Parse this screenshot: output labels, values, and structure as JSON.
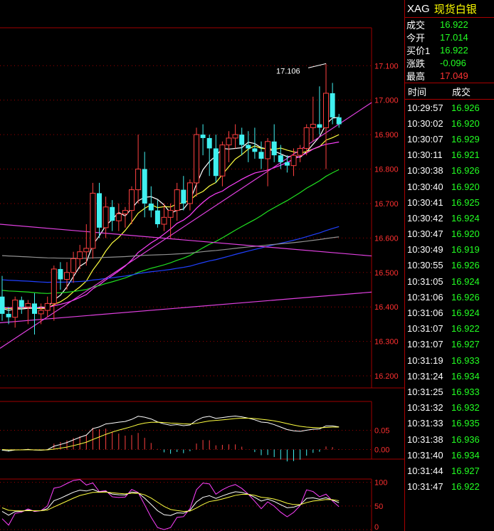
{
  "header": {
    "symbol": "XAG",
    "name": "现货白银"
  },
  "quote": [
    {
      "label": "成交",
      "value": "16.922",
      "color": "green"
    },
    {
      "label": "今开",
      "value": "17.014",
      "color": "green"
    },
    {
      "label": "买价1",
      "value": "16.922",
      "color": "green"
    },
    {
      "label": "涨跌",
      "value": "-0.096",
      "color": "green"
    },
    {
      "label": "最高",
      "value": "17.049",
      "color": "red"
    }
  ],
  "trades_header": {
    "time": "时间",
    "price": "成交"
  },
  "trades": [
    {
      "time": "10:29:57",
      "price": "16.926"
    },
    {
      "time": "10:30:02",
      "price": "16.920"
    },
    {
      "time": "10:30:07",
      "price": "16.929"
    },
    {
      "time": "10:30:11",
      "price": "16.921"
    },
    {
      "time": "10:30:38",
      "price": "16.926"
    },
    {
      "time": "10:30:40",
      "price": "16.920"
    },
    {
      "time": "10:30:41",
      "price": "16.925"
    },
    {
      "time": "10:30:42",
      "price": "16.924"
    },
    {
      "time": "10:30:47",
      "price": "16.920"
    },
    {
      "time": "10:30:49",
      "price": "16.919"
    },
    {
      "time": "10:30:55",
      "price": "16.926"
    },
    {
      "time": "10:31:05",
      "price": "16.924"
    },
    {
      "time": "10:31:06",
      "price": "16.926"
    },
    {
      "time": "10:31:06",
      "price": "16.924"
    },
    {
      "time": "10:31:07",
      "price": "16.922"
    },
    {
      "time": "10:31:07",
      "price": "16.927"
    },
    {
      "time": "10:31:19",
      "price": "16.933"
    },
    {
      "time": "10:31:24",
      "price": "16.934"
    },
    {
      "time": "10:31:25",
      "price": "16.933"
    },
    {
      "time": "10:31:32",
      "price": "16.932"
    },
    {
      "time": "10:31:33",
      "price": "16.935"
    },
    {
      "time": "10:31:38",
      "price": "16.936"
    },
    {
      "time": "10:31:40",
      "price": "16.934"
    },
    {
      "time": "10:31:44",
      "price": "16.927"
    },
    {
      "time": "10:31:47",
      "price": "16.922"
    }
  ],
  "chart_data": [
    {
      "type": "candlestick",
      "y_ticks": [
        "17.100",
        "17.000",
        "16.900",
        "16.800",
        "16.700",
        "16.600",
        "16.500",
        "16.400",
        "16.300",
        "16.200"
      ],
      "ylim": [
        16.165,
        17.21
      ],
      "high_annotation": "17.106",
      "colors": {
        "up": "#ff4040",
        "down": "#40f0f0",
        "grid": "#a00000"
      },
      "candles": [
        {
          "o": 16.43,
          "h": 16.49,
          "l": 16.36,
          "c": 16.38
        },
        {
          "o": 16.38,
          "h": 16.4,
          "l": 16.35,
          "c": 16.37
        },
        {
          "o": 16.37,
          "h": 16.43,
          "l": 16.34,
          "c": 16.42
        },
        {
          "o": 16.42,
          "h": 16.43,
          "l": 16.38,
          "c": 16.4
        },
        {
          "o": 16.4,
          "h": 16.42,
          "l": 16.35,
          "c": 16.41
        },
        {
          "o": 16.41,
          "h": 16.44,
          "l": 16.32,
          "c": 16.38
        },
        {
          "o": 16.38,
          "h": 16.41,
          "l": 16.35,
          "c": 16.39
        },
        {
          "o": 16.39,
          "h": 16.43,
          "l": 16.37,
          "c": 16.41
        },
        {
          "o": 16.41,
          "h": 16.52,
          "l": 16.36,
          "c": 16.51
        },
        {
          "o": 16.51,
          "h": 16.53,
          "l": 16.45,
          "c": 16.48
        },
        {
          "o": 16.48,
          "h": 16.53,
          "l": 16.45,
          "c": 16.5
        },
        {
          "o": 16.5,
          "h": 16.56,
          "l": 16.47,
          "c": 16.54
        },
        {
          "o": 16.54,
          "h": 16.58,
          "l": 16.51,
          "c": 16.56
        },
        {
          "o": 16.56,
          "h": 16.64,
          "l": 16.52,
          "c": 16.57
        },
        {
          "o": 16.57,
          "h": 16.76,
          "l": 16.54,
          "c": 16.73
        },
        {
          "o": 16.73,
          "h": 16.76,
          "l": 16.6,
          "c": 16.63
        },
        {
          "o": 16.63,
          "h": 16.72,
          "l": 16.6,
          "c": 16.69
        },
        {
          "o": 16.69,
          "h": 16.71,
          "l": 16.62,
          "c": 16.65
        },
        {
          "o": 16.65,
          "h": 16.7,
          "l": 16.62,
          "c": 16.67
        },
        {
          "o": 16.67,
          "h": 16.69,
          "l": 16.63,
          "c": 16.68
        },
        {
          "o": 16.68,
          "h": 16.75,
          "l": 16.64,
          "c": 16.74
        },
        {
          "o": 16.74,
          "h": 16.9,
          "l": 16.7,
          "c": 16.8
        },
        {
          "o": 16.8,
          "h": 16.85,
          "l": 16.66,
          "c": 16.7
        },
        {
          "o": 16.7,
          "h": 16.75,
          "l": 16.66,
          "c": 16.68
        },
        {
          "o": 16.68,
          "h": 16.71,
          "l": 16.63,
          "c": 16.64
        },
        {
          "o": 16.64,
          "h": 16.7,
          "l": 16.62,
          "c": 16.66
        },
        {
          "o": 16.66,
          "h": 16.7,
          "l": 16.6,
          "c": 16.68
        },
        {
          "o": 16.68,
          "h": 16.76,
          "l": 16.65,
          "c": 16.74
        },
        {
          "o": 16.74,
          "h": 16.78,
          "l": 16.68,
          "c": 16.7
        },
        {
          "o": 16.7,
          "h": 16.77,
          "l": 16.68,
          "c": 16.76
        },
        {
          "o": 16.76,
          "h": 16.92,
          "l": 16.72,
          "c": 16.9
        },
        {
          "o": 16.9,
          "h": 16.93,
          "l": 16.84,
          "c": 16.89
        },
        {
          "o": 16.89,
          "h": 16.9,
          "l": 16.78,
          "c": 16.86
        },
        {
          "o": 16.86,
          "h": 16.9,
          "l": 16.76,
          "c": 16.78
        },
        {
          "o": 16.78,
          "h": 16.88,
          "l": 16.75,
          "c": 16.87
        },
        {
          "o": 16.87,
          "h": 16.91,
          "l": 16.82,
          "c": 16.89
        },
        {
          "o": 16.89,
          "h": 16.93,
          "l": 16.86,
          "c": 16.9
        },
        {
          "o": 16.9,
          "h": 16.92,
          "l": 16.84,
          "c": 16.87
        },
        {
          "o": 16.87,
          "h": 16.91,
          "l": 16.82,
          "c": 16.86
        },
        {
          "o": 16.86,
          "h": 16.92,
          "l": 16.83,
          "c": 16.85
        },
        {
          "o": 16.85,
          "h": 16.88,
          "l": 16.8,
          "c": 16.83
        },
        {
          "o": 16.83,
          "h": 16.89,
          "l": 16.75,
          "c": 16.88
        },
        {
          "o": 16.88,
          "h": 16.93,
          "l": 16.82,
          "c": 16.84
        },
        {
          "o": 16.84,
          "h": 16.87,
          "l": 16.8,
          "c": 16.82
        },
        {
          "o": 16.82,
          "h": 16.84,
          "l": 16.79,
          "c": 16.81
        },
        {
          "o": 16.81,
          "h": 16.86,
          "l": 16.78,
          "c": 16.84
        },
        {
          "o": 16.84,
          "h": 16.87,
          "l": 16.82,
          "c": 16.86
        },
        {
          "o": 16.86,
          "h": 16.93,
          "l": 16.84,
          "c": 16.92
        },
        {
          "o": 16.92,
          "h": 17.01,
          "l": 16.88,
          "c": 16.93
        },
        {
          "o": 16.93,
          "h": 17.04,
          "l": 16.9,
          "c": 16.92
        },
        {
          "o": 16.92,
          "h": 17.106,
          "l": 16.8,
          "c": 17.02
        },
        {
          "o": 17.02,
          "h": 17.05,
          "l": 16.93,
          "c": 16.95
        },
        {
          "o": 16.95,
          "h": 16.96,
          "l": 16.92,
          "c": 16.93
        }
      ]
    },
    {
      "type": "macd",
      "y_ticks": [
        "0.05",
        "0.00"
      ],
      "ylim": [
        -0.025,
        0.125
      ]
    },
    {
      "type": "kdj",
      "y_ticks": [
        "100",
        "50",
        "0"
      ],
      "ylim": [
        0,
        110
      ]
    }
  ]
}
